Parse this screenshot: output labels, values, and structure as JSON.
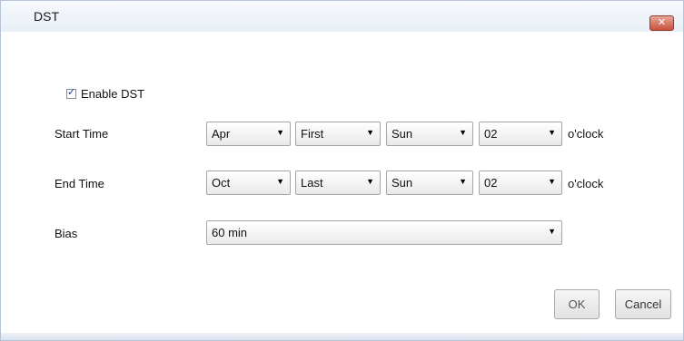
{
  "dialog": {
    "title": "DST",
    "close_icon": "close-icon"
  },
  "enable_dst": {
    "label": "Enable DST",
    "checked": true
  },
  "rows": {
    "start": {
      "label": "Start Time",
      "month": "Apr",
      "week": "First",
      "day": "Sun",
      "hour": "02",
      "unit": "o'clock"
    },
    "end": {
      "label": "End Time",
      "month": "Oct",
      "week": "Last",
      "day": "Sun",
      "hour": "02",
      "unit": "o'clock"
    }
  },
  "bias": {
    "label": "Bias",
    "value": "60 min"
  },
  "buttons": {
    "ok": "OK",
    "cancel": "Cancel"
  }
}
